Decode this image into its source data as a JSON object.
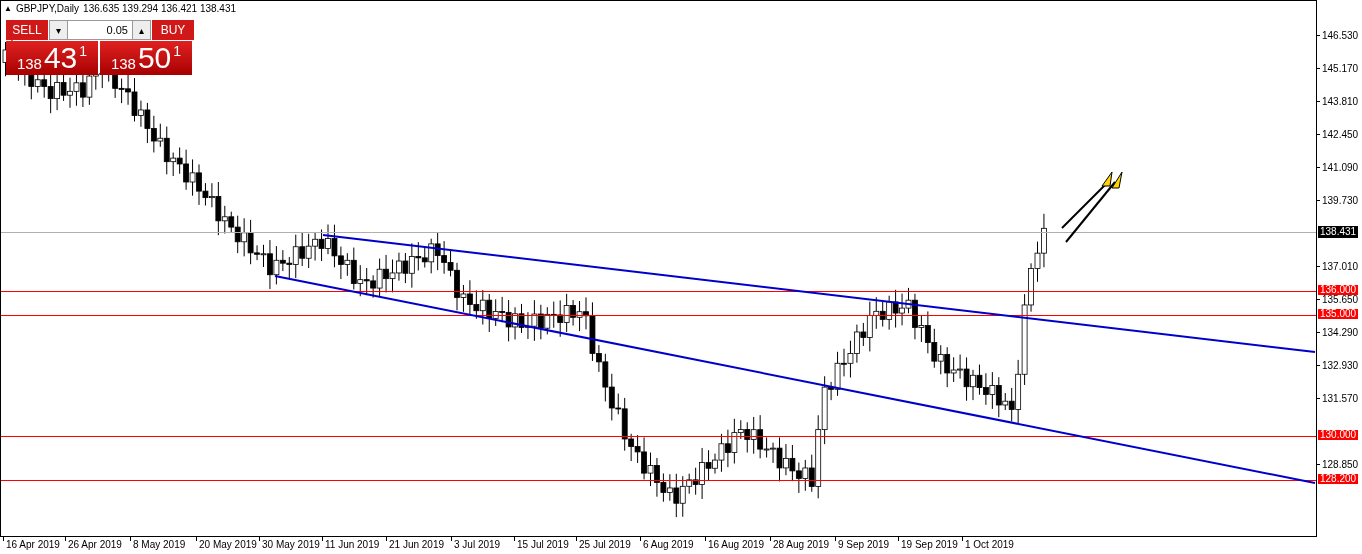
{
  "header": {
    "collapse": "▲",
    "symbol": "GBPJPY,Daily",
    "ohlc": "136.635 139.294 136.421 138.431"
  },
  "trade_panel": {
    "sell_label": "SELL",
    "buy_label": "BUY",
    "down": "▾",
    "up": "▴",
    "lot": "0.05",
    "sell_price": {
      "big": "138",
      "main": "43",
      "sup": "1"
    },
    "buy_price": {
      "big": "138",
      "main": "50",
      "sup": "1"
    }
  },
  "price_axis": [
    "146.530",
    "145.170",
    "143.810",
    "142.450",
    "141.090",
    "139.730",
    "137.010",
    "135.650",
    "134.290",
    "132.930",
    "131.570",
    "128.850"
  ],
  "current_price": "138.431",
  "levels": [
    {
      "label": "136.000",
      "color": "#ff0000"
    },
    {
      "label": "135.000",
      "color": "#ff0000"
    },
    {
      "label": "130.000",
      "color": "#ff0000"
    },
    {
      "label": "128.200",
      "color": "#ff0000"
    }
  ],
  "date_axis": [
    "16 Apr 2019",
    "26 Apr 2019",
    "8 May 2019",
    "20 May 2019",
    "30 May 2019",
    "11 Jun 2019",
    "21 Jun 2019",
    "3 Jul 2019",
    "15 Jul 2019",
    "25 Jul 2019",
    "6 Aug 2019",
    "16 Aug 2019",
    "28 Aug 2019",
    "9 Sep 2019",
    "19 Sep 2019",
    "1 Oct 2019"
  ]
}
